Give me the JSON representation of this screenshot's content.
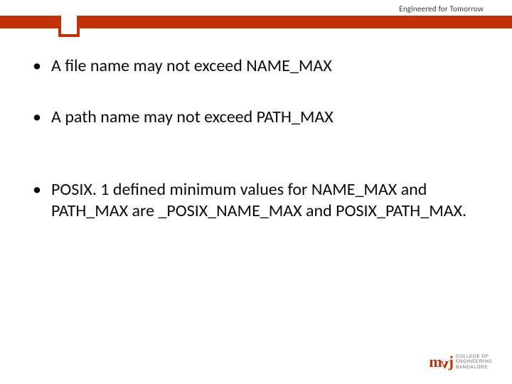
{
  "header": {
    "tagline": "Engineered for Tomorrow"
  },
  "bullets": [
    "A file name may not exceed NAME_MAX",
    "A path name may not exceed PATH_MAX",
    "POSIX. 1 defined minimum values for NAME_MAX and PATH_MAX are _POSIX_NAME_MAX and POSIX_PATH_MAX."
  ],
  "logo": {
    "mark": "mvj",
    "line1": "COLLEGE OF",
    "line2": "ENGINEERING",
    "line3": "BANGALORE"
  }
}
